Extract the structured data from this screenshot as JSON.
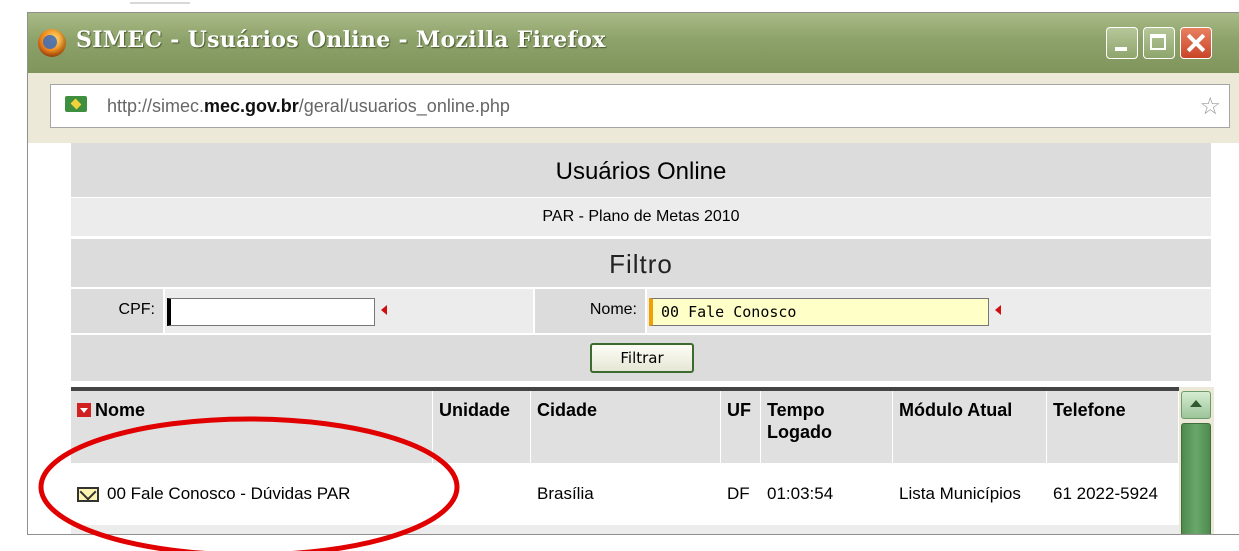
{
  "window": {
    "title": "SIMEC - Usuários Online - Mozilla Firefox",
    "url_prefix": "http://simec.",
    "url_domain": "mec.gov.br",
    "url_suffix": "/geral/usuarios_online.php"
  },
  "page": {
    "title": "Usuários Online",
    "subtitle": "PAR - Plano de Metas 2010",
    "filter_title": "Filtro",
    "cpf_label": "CPF:",
    "cpf_value": "",
    "nome_label": "Nome:",
    "nome_value": "00 Fale Conosco",
    "filter_button": "Filtrar"
  },
  "table": {
    "headers": {
      "nome": "Nome",
      "unidade": "Unidade",
      "cidade": "Cidade",
      "uf": "UF",
      "tempo": "Tempo Logado",
      "modulo": "Módulo Atual",
      "telefone": "Telefone"
    },
    "rows": [
      {
        "nome": "00 Fale Conosco - Dúvidas PAR",
        "unidade": "",
        "cidade": "Brasília",
        "uf": "DF",
        "tempo": "01:03:54",
        "modulo": "Lista Municípios",
        "telefone": "61 2022-5924"
      }
    ]
  },
  "colors": {
    "titlebar": "#8da26a",
    "annotation_circle": "#e00000",
    "required_marker": "#d01010"
  },
  "icons": [
    "firefox-icon",
    "site-icon",
    "star-icon",
    "sort-icon",
    "mail-icon"
  ]
}
